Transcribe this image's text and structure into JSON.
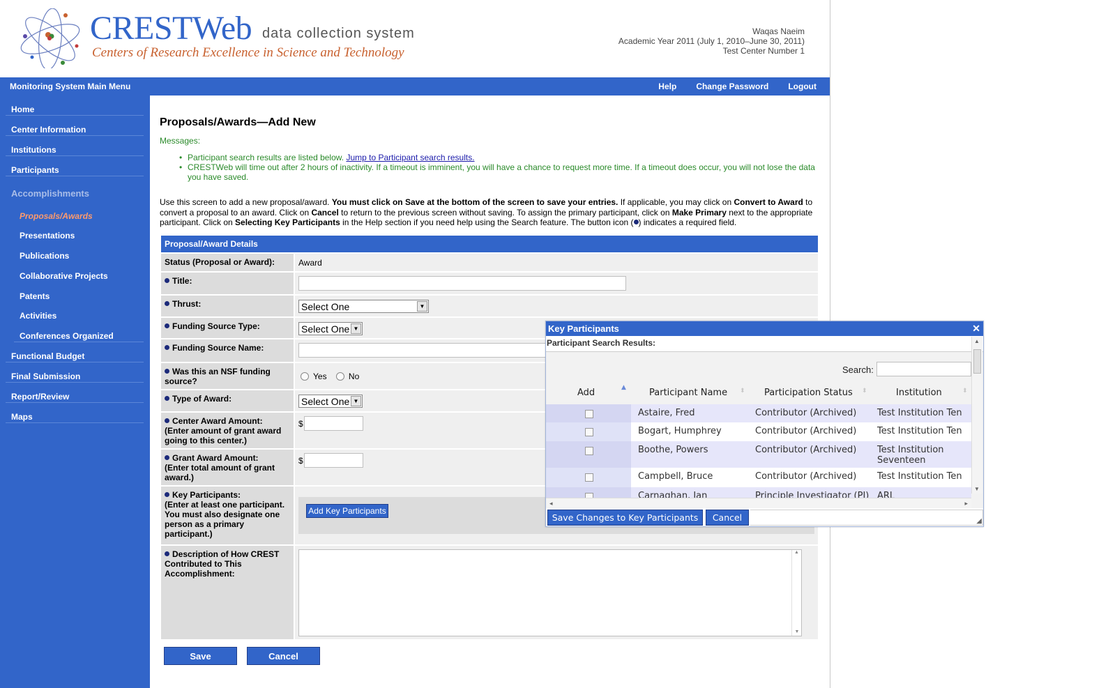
{
  "header": {
    "brand_name": "CRESTWeb",
    "brand_sub": "data collection system",
    "brand_tagline": "Centers of Research Excellence in Science and Technology",
    "user_name": "Waqas Naeim",
    "academic_year": "Academic Year 2011 (July 1, 2010–June 30, 2011)",
    "center": "Test Center Number 1"
  },
  "topnav": {
    "main_menu": "Monitoring System Main Menu",
    "help": "Help",
    "change_password": "Change Password",
    "logout": "Logout"
  },
  "sidebar": {
    "items": [
      {
        "label": "Home"
      },
      {
        "label": "Center Information"
      },
      {
        "label": "Institutions"
      },
      {
        "label": "Participants"
      },
      {
        "label": "Accomplishments"
      },
      {
        "label": "Proposals/Awards"
      },
      {
        "label": "Presentations"
      },
      {
        "label": "Publications"
      },
      {
        "label": "Collaborative Projects"
      },
      {
        "label": "Patents"
      },
      {
        "label": "Activities"
      },
      {
        "label": "Conferences Organized"
      },
      {
        "label": "Functional Budget"
      },
      {
        "label": "Final Submission"
      },
      {
        "label": "Report/Review"
      },
      {
        "label": "Maps"
      }
    ]
  },
  "main": {
    "title": "Proposals/Awards—Add New",
    "messages_label": "Messages:",
    "msg1_text": "Participant search results are listed below. ",
    "msg1_link": "Jump to Participant search results.",
    "msg2": "CRESTWeb will time out after 2 hours of inactivity. If a timeout is imminent, you will have a chance to request more time. If a timeout does occur, you will not lose the data you have saved.",
    "instr": {
      "p1": "Use this screen to add a new proposal/award. ",
      "b1": "You must click on ",
      "b2": "Save",
      "b3": " at the bottom of the screen to save your entries.",
      "p2": " If applicable, you may click on ",
      "b4": "Convert to Award",
      "p3": " to convert a proposal to an award. Click on ",
      "b5": "Cancel",
      "p4": " to return to the previous screen without saving. To assign the primary participant, click on ",
      "b6": "Make Primary",
      "p5": " next to the appropriate participant. Click on ",
      "b7": "Selecting Key Participants",
      "p6": " in the Help section if you need help using the Search feature. The button icon (",
      "p7": ") indicates a required field."
    }
  },
  "details": {
    "header": "Proposal/Award Details",
    "status_label": "Status (Proposal or Award):",
    "status_value": "Award",
    "title_label": "Title:",
    "title_value": "",
    "thrust_label": "Thrust:",
    "thrust_value": "Select One",
    "fst_label": "Funding Source Type:",
    "fst_value": "Select One",
    "fsn_label": "Funding Source Name:",
    "fsn_value": "",
    "nsf_label": "Was this an NSF funding source?",
    "nsf_yes": "Yes",
    "nsf_no": "No",
    "toa_label": "Type of Award:",
    "toa_value": "Select One",
    "caa_label": "Center Award Amount:",
    "caa_hint": "(Enter amount of grant award going to this center.)",
    "caa_value": "",
    "gaa_label": "Grant Award Amount:",
    "gaa_hint": "(Enter total amount of grant award.)",
    "gaa_value": "",
    "currency": "$",
    "kp_label": "Key Participants:",
    "kp_hint": "(Enter at least one participant. You must also designate one person as a primary participant.)",
    "kp_button": "Add Key Participants",
    "desc_label": "Description of How CREST Contributed to This Accomplishment:",
    "desc_value": ""
  },
  "actions": {
    "save": "Save",
    "cancel": "Cancel"
  },
  "modal": {
    "title": "Key Participants",
    "subtitle": "Participant Search Results:",
    "search_label": "Search:",
    "search_value": "",
    "columns": [
      "Add",
      "Participant Name",
      "Participation Status",
      "Institution"
    ],
    "rows": [
      {
        "name": "Astaire, Fred",
        "status": "Contributor (Archived)",
        "institution": "Test Institution Ten"
      },
      {
        "name": "Bogart, Humphrey",
        "status": "Contributor (Archived)",
        "institution": "Test Institution Ten"
      },
      {
        "name": "Boothe, Powers",
        "status": "Contributor (Archived)",
        "institution": "Test Institution Seventeen"
      },
      {
        "name": "Campbell, Bruce",
        "status": "Contributor (Archived)",
        "institution": "Test Institution Ten"
      },
      {
        "name": "Carnaghan, Jan",
        "status": "Principle Investigator (PI)",
        "institution": "ARL"
      }
    ],
    "save_button": "Save Changes to Key Participants",
    "cancel_button": "Cancel"
  },
  "colors": {
    "primary_blue": "#3265c9",
    "brand_orange": "#c8612f",
    "message_green": "#2a8a2a",
    "active_nav": "#ff9a6c"
  }
}
